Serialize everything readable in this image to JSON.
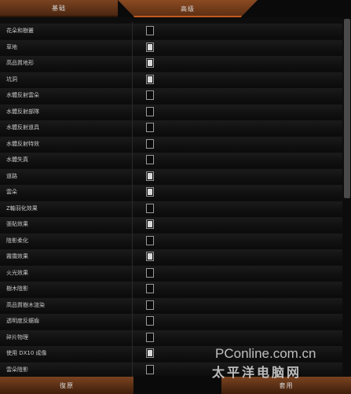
{
  "tabs": {
    "basic": "基础",
    "advanced": "高级"
  },
  "settings": [
    {
      "label": "花朵和樹叢",
      "checked": false
    },
    {
      "label": "草地",
      "checked": true
    },
    {
      "label": "高品質地形",
      "checked": true
    },
    {
      "label": "坑洞",
      "checked": true
    },
    {
      "label": "水體反射雲朵",
      "checked": false
    },
    {
      "label": "水體反射部隊",
      "checked": false
    },
    {
      "label": "水體反射道具",
      "checked": false
    },
    {
      "label": "水體反射特效",
      "checked": false
    },
    {
      "label": "水體失真",
      "checked": false
    },
    {
      "label": "道路",
      "checked": true
    },
    {
      "label": "雲朵",
      "checked": true
    },
    {
      "label": "Z軸羽化效果",
      "checked": false
    },
    {
      "label": "張貼效果",
      "checked": true
    },
    {
      "label": "陰影柔化",
      "checked": false
    },
    {
      "label": "霧靄效果",
      "checked": true
    },
    {
      "label": "火光效果",
      "checked": false
    },
    {
      "label": "樹木陰影",
      "checked": false
    },
    {
      "label": "高品質樹木渲染",
      "checked": false
    },
    {
      "label": "透明度反鋸齒",
      "checked": false
    },
    {
      "label": "碎片物理",
      "checked": false
    },
    {
      "label": "使用 DX10 成像",
      "checked": true
    },
    {
      "label": "雲朵陰影",
      "checked": false
    }
  ],
  "buttons": {
    "restore": "復原",
    "apply": "套用"
  },
  "watermark": {
    "site": "PConline.com.cn",
    "name": "太平洋电脑网"
  },
  "scrollbar": {
    "position": 0.0,
    "visible_fraction": 0.5
  }
}
